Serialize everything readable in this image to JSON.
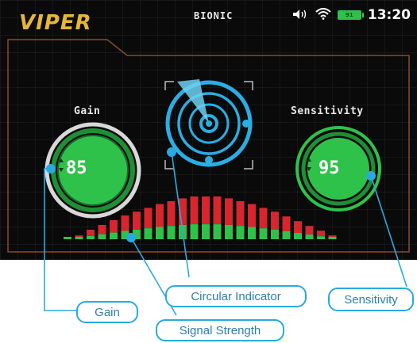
{
  "header": {
    "logo_text": "VIPER",
    "mode_label": "BIONIC",
    "battery_level": "91",
    "time": "13:20",
    "icons": [
      "volume-icon",
      "wifi-icon",
      "battery-icon"
    ]
  },
  "gain": {
    "label": "Gain",
    "value": "85",
    "level": 0.85
  },
  "sensitivity": {
    "label": "Sensitivity",
    "value": "95",
    "level": 0.95
  },
  "signal_strength": {
    "bars": [
      0.05,
      0.08,
      0.2,
      0.3,
      0.4,
      0.5,
      0.58,
      0.66,
      0.74,
      0.8,
      0.86,
      0.9,
      0.9,
      0.9,
      0.86,
      0.8,
      0.74,
      0.66,
      0.58,
      0.48,
      0.38,
      0.28,
      0.18,
      0.08
    ]
  },
  "callouts": {
    "gain": "Gain",
    "circular_indicator": "Circular Indicator",
    "signal_strength": "Signal Strength",
    "sensitivity": "Sensitivity"
  },
  "colors": {
    "accent_green": "#2fc24a",
    "accent_blue": "#29aee6",
    "logo_gold": "#e8b636",
    "bar_red": "#d7262e"
  }
}
